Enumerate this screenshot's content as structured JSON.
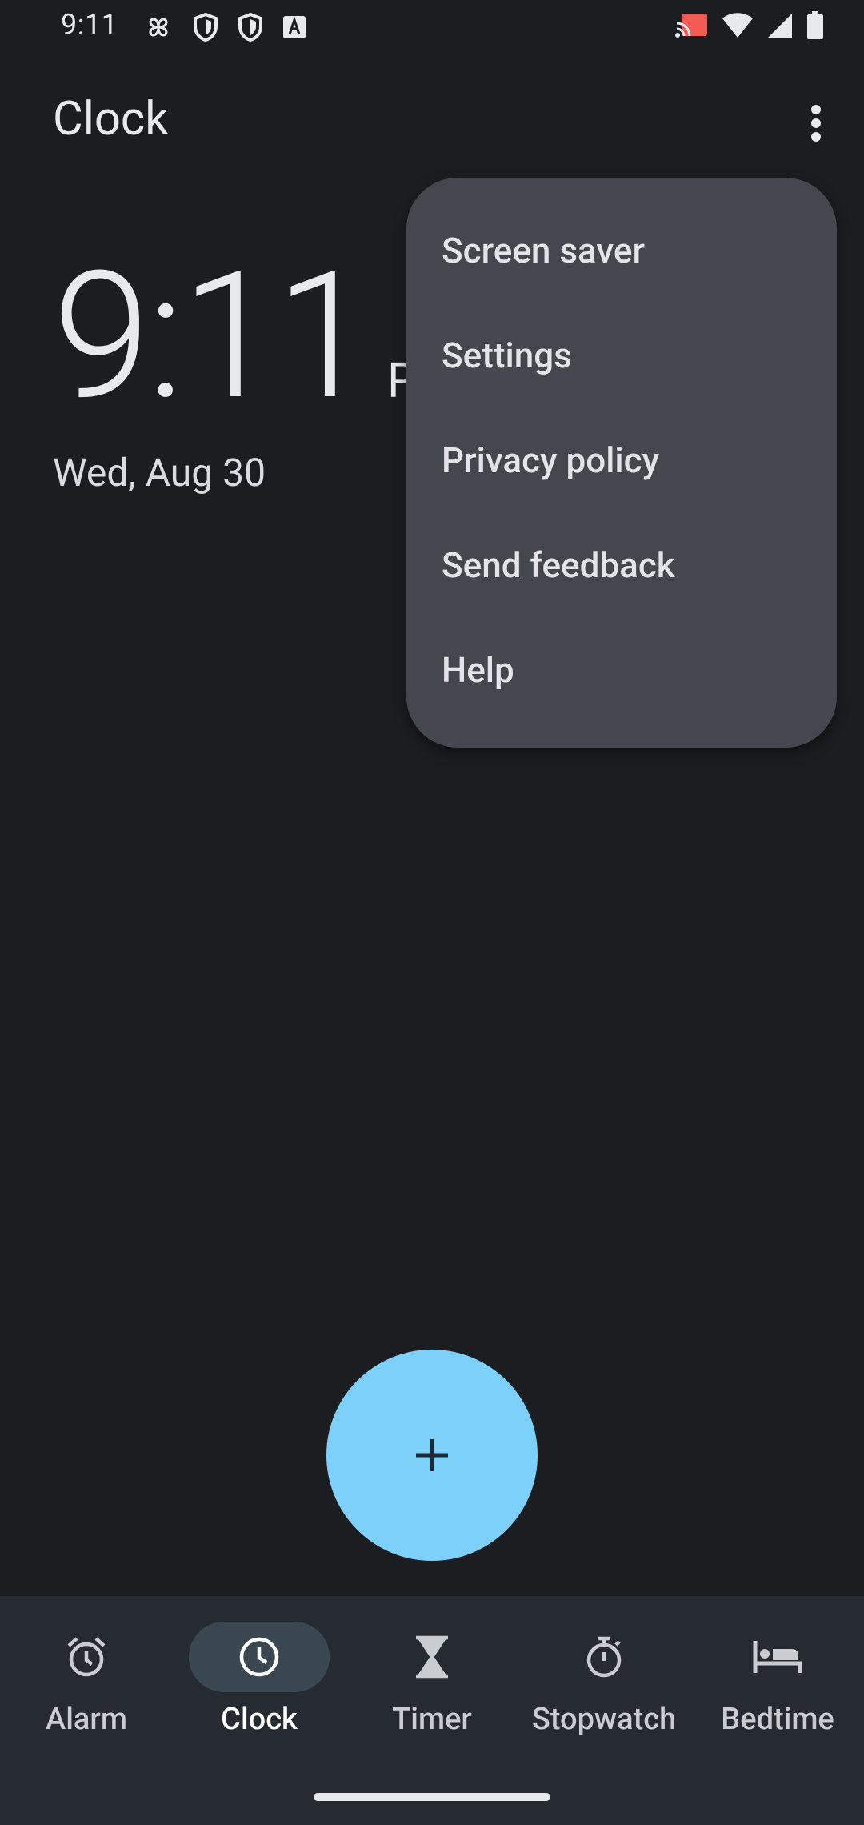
{
  "status_bar": {
    "time": "9:11",
    "left_icons": [
      "pinwheel-icon",
      "shield-icon",
      "shield-icon",
      "font-a-icon"
    ],
    "right_icons": [
      "cast-icon",
      "wifi-icon",
      "signal-icon",
      "battery-icon"
    ]
  },
  "header": {
    "title": "Clock"
  },
  "clock": {
    "time": "9:11",
    "suffix_partial": "P",
    "date": "Wed, Aug 30"
  },
  "menu": {
    "items": [
      {
        "label": "Screen saver"
      },
      {
        "label": "Settings"
      },
      {
        "label": "Privacy policy"
      },
      {
        "label": "Send feedback"
      },
      {
        "label": "Help"
      }
    ]
  },
  "fab": {
    "icon": "plus-icon",
    "color": "#7cd0fa"
  },
  "bottom_nav": {
    "active": "Clock",
    "items": [
      {
        "label": "Alarm",
        "icon": "alarm-icon"
      },
      {
        "label": "Clock",
        "icon": "clock-icon"
      },
      {
        "label": "Timer",
        "icon": "hourglass-icon"
      },
      {
        "label": "Stopwatch",
        "icon": "stopwatch-icon"
      },
      {
        "label": "Bedtime",
        "icon": "bed-icon"
      }
    ]
  },
  "colors": {
    "background": "#1b1d20",
    "menu_background": "#44484e",
    "nav_background": "#262b32",
    "accent": "#7cd0fa"
  }
}
